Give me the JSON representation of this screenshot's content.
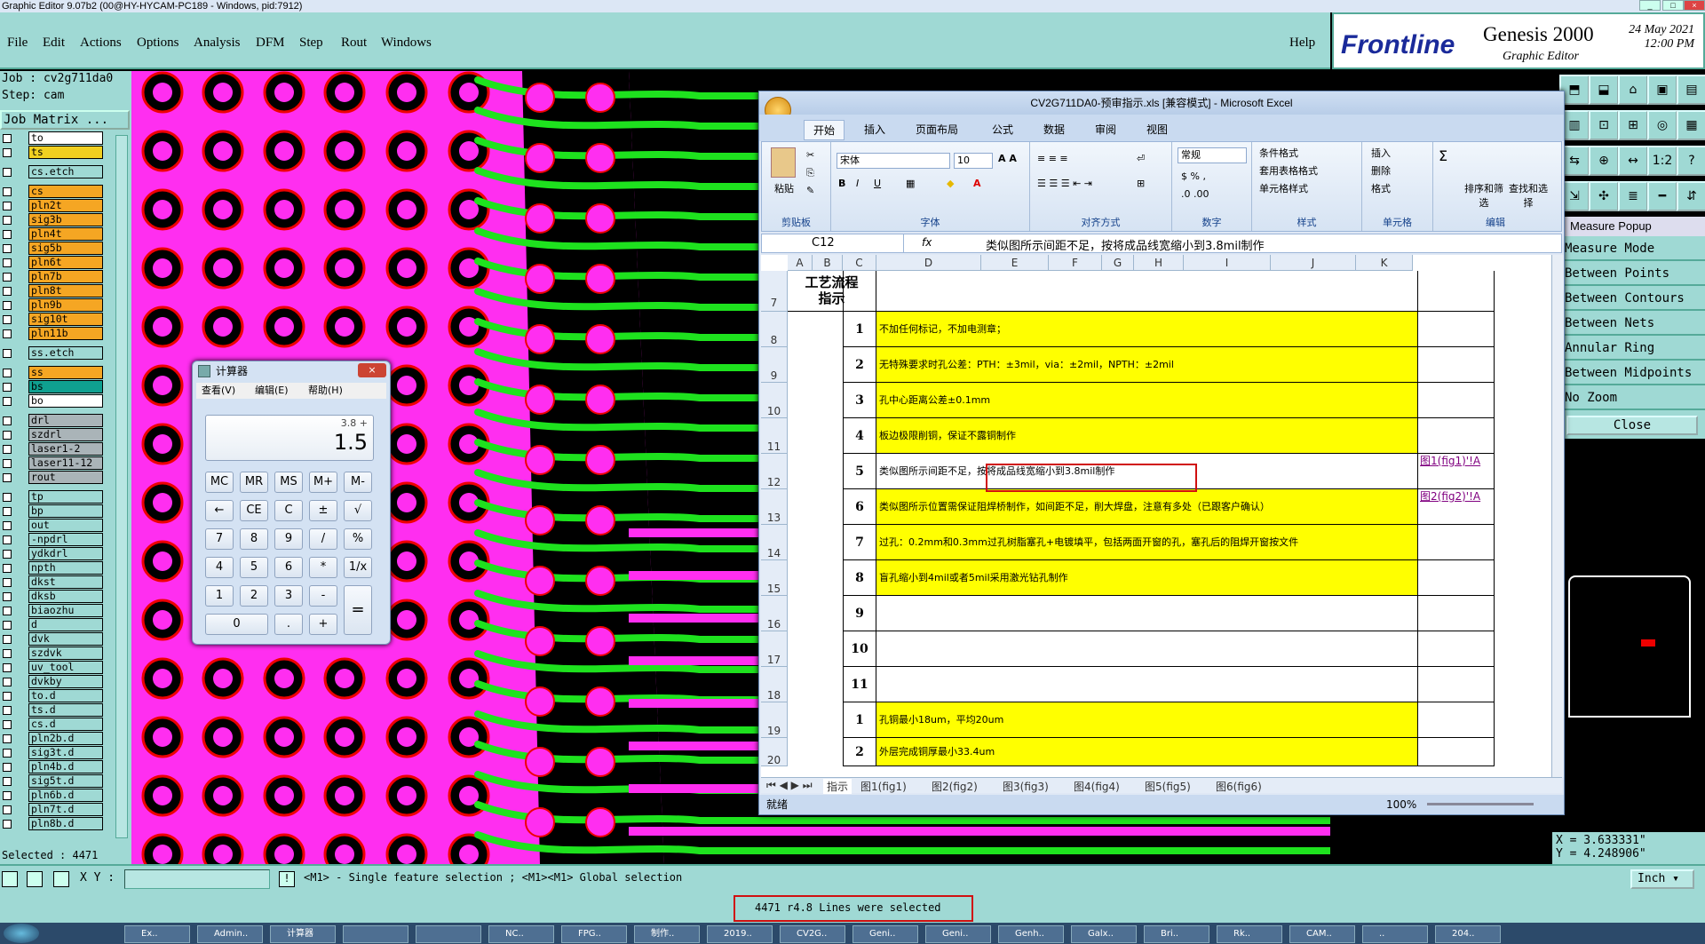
{
  "app": {
    "title": "Graphic Editor 9.07b2 (00@HY-HYCAM-PC189 - Windows, pid:7912)"
  },
  "menu": [
    "File",
    "Edit",
    "Actions",
    "Options",
    "Analysis",
    "DFM",
    "Step",
    "Rout",
    "Windows"
  ],
  "help": "Help",
  "brand": {
    "logo": "Frontline",
    "product": "Genesis 2000",
    "sub": "Graphic Editor",
    "date": "24 May 2021",
    "time": "12:00 PM"
  },
  "job": {
    "job": "Job : cv2g711da0",
    "step": "Step: cam",
    "matrix": "Job Matrix ..."
  },
  "layers": [
    {
      "name": "to",
      "color": "#ffffff"
    },
    {
      "name": "ts",
      "color": "#f0d020"
    },
    {
      "name": "cs.etch",
      "color": "#9fd9d4"
    },
    {
      "name": "cs",
      "color": "#f5a623"
    },
    {
      "name": "pln2t",
      "color": "#f5a623"
    },
    {
      "name": "sig3b",
      "color": "#f5a623"
    },
    {
      "name": "pln4t",
      "color": "#f5a623"
    },
    {
      "name": "sig5b",
      "color": "#f5a623"
    },
    {
      "name": "pln6t",
      "color": "#f5a623"
    },
    {
      "name": "pln7b",
      "color": "#f5a623"
    },
    {
      "name": "pln8t",
      "color": "#f5a623"
    },
    {
      "name": "pln9b",
      "color": "#f5a623"
    },
    {
      "name": "sig10t",
      "color": "#f5a623"
    },
    {
      "name": "pln11b",
      "color": "#f5a623"
    },
    {
      "name": "ss.etch",
      "color": "#9fd9d4"
    },
    {
      "name": "ss",
      "color": "#f5a623"
    },
    {
      "name": "bs",
      "color": "#0fa090"
    },
    {
      "name": "bo",
      "color": "#ffffff"
    },
    {
      "name": "drl",
      "color": "#aab4b8"
    },
    {
      "name": "szdrl",
      "color": "#aab4b8"
    },
    {
      "name": "laser1-2",
      "color": "#aab4b8"
    },
    {
      "name": "laser11-12",
      "color": "#aab4b8"
    },
    {
      "name": "rout",
      "color": "#aab4b8"
    },
    {
      "name": "tp",
      "color": "#9fd9d4"
    },
    {
      "name": "bp",
      "color": "#9fd9d4"
    },
    {
      "name": "out",
      "color": "#9fd9d4"
    },
    {
      "name": "-npdrl",
      "color": "#9fd9d4"
    },
    {
      "name": "ydkdrl",
      "color": "#9fd9d4"
    },
    {
      "name": "npth",
      "color": "#9fd9d4"
    },
    {
      "name": "dkst",
      "color": "#9fd9d4"
    },
    {
      "name": "dksb",
      "color": "#9fd9d4"
    },
    {
      "name": "biaozhu",
      "color": "#9fd9d4"
    },
    {
      "name": "d",
      "color": "#9fd9d4"
    },
    {
      "name": "dvk",
      "color": "#9fd9d4"
    },
    {
      "name": "szdvk",
      "color": "#9fd9d4"
    },
    {
      "name": "uv_tool",
      "color": "#9fd9d4"
    },
    {
      "name": "dvkby",
      "color": "#9fd9d4"
    },
    {
      "name": "to.d",
      "color": "#9fd9d4"
    },
    {
      "name": "ts.d",
      "color": "#9fd9d4"
    },
    {
      "name": "cs.d",
      "color": "#9fd9d4"
    },
    {
      "name": "pln2b.d",
      "color": "#9fd9d4"
    },
    {
      "name": "sig3t.d",
      "color": "#9fd9d4"
    },
    {
      "name": "pln4b.d",
      "color": "#9fd9d4"
    },
    {
      "name": "sig5t.d",
      "color": "#9fd9d4"
    },
    {
      "name": "pln6b.d",
      "color": "#9fd9d4"
    },
    {
      "name": "pln7t.d",
      "color": "#9fd9d4"
    },
    {
      "name": "pln8b.d",
      "color": "#9fd9d4"
    }
  ],
  "selected": "Selected : 4471",
  "measure": {
    "title": "Measure Popup",
    "items": [
      "Measure Mode",
      "Between Points",
      "Between Contours",
      "Between Nets",
      "Annular Ring",
      "Between Midpoints"
    ],
    "zoom": "No Zoom",
    "close": "Close"
  },
  "coords": {
    "x": "X = 3.633331\"",
    "y": "Y = 4.248906\""
  },
  "bottom": {
    "xy_label": "X Y :",
    "hint": "<M1> - Single feature selection ; <M1><M1> Global selection",
    "unit": "Inch"
  },
  "status": "4471 r4.8 Lines were selected",
  "excel": {
    "title": "CV2G711DA0-预审指示.xls  [兼容模式] - Microsoft Excel",
    "tabs": [
      "开始",
      "插入",
      "页面布局",
      "公式",
      "数据",
      "审阅",
      "视图"
    ],
    "font": "宋体",
    "size": "10",
    "numfmt": "常规",
    "groups": [
      "剪贴板",
      "字体",
      "对齐方式",
      "数字",
      "样式",
      "单元格",
      "编辑"
    ],
    "paste": "粘贴",
    "styles": [
      "条件格式",
      "套用表格格式",
      "单元格样式"
    ],
    "cellsops": [
      "插入",
      "删除",
      "格式"
    ],
    "edit": [
      "排序和筛选",
      "查找和选择"
    ],
    "cellref": "C12",
    "formula": "类似图所示间距不足，按将成品线宽缩小到3.8mil制作",
    "cols": [
      "A",
      "B",
      "C",
      "D",
      "E",
      "F",
      "G",
      "H",
      "I",
      "J",
      "K"
    ],
    "section": "工艺流程指示",
    "rows": [
      {
        "r": "7",
        "n": "",
        "t": "",
        "link": "",
        "yellow": false
      },
      {
        "r": "8",
        "n": "1",
        "t": "不加任何标记，不加电测章；",
        "link": "",
        "yellow": true
      },
      {
        "r": "9",
        "n": "2",
        "t": "无特殊要求时孔公差：PTH：±3mil，via：±2mil，NPTH：±2mil",
        "link": "",
        "yellow": true
      },
      {
        "r": "10",
        "n": "3",
        "t": "孔中心距离公差±0.1mm",
        "link": "",
        "yellow": true
      },
      {
        "r": "11",
        "n": "4",
        "t": "板边极限削铜，保证不露铜制作",
        "link": "",
        "yellow": true
      },
      {
        "r": "12",
        "n": "5",
        "t": "类似图所示间距不足，按将成品线宽缩小到3.8mil制作",
        "link": "图1(fig1)'!A",
        "yellow": false
      },
      {
        "r": "13",
        "n": "6",
        "t": "类似图所示位置需保证阻焊桥制作，如间距不足，削大焊盘，注意有多处（已跟客户确认）",
        "link": "图2(fig2)'!A",
        "yellow": true
      },
      {
        "r": "14",
        "n": "7",
        "t": "过孔：0.2mm和0.3mm过孔树脂塞孔+电镀填平，包括两面开窗的孔，塞孔后的阻焊开窗按文件",
        "link": "",
        "yellow": true
      },
      {
        "r": "15",
        "n": "8",
        "t": "盲孔缩小到4mil或者5mil采用激光钻孔制作",
        "link": "",
        "yellow": true
      },
      {
        "r": "16",
        "n": "9",
        "t": "",
        "link": "",
        "yellow": false
      },
      {
        "r": "17",
        "n": "10",
        "t": "",
        "link": "",
        "yellow": false
      },
      {
        "r": "18",
        "n": "11",
        "t": "",
        "link": "",
        "yellow": false
      },
      {
        "r": "19",
        "n": "1",
        "t": "孔铜最小18um，平均20um",
        "link": "",
        "yellow": true
      },
      {
        "r": "20",
        "n": "2",
        "t": "外层完成铜厚最小33.4um",
        "link": "",
        "yellow": true
      }
    ],
    "sheets": [
      "指示",
      "图1(fig1)",
      "图2(fig2)",
      "图3(fig3)",
      "图4(fig4)",
      "图5(fig5)",
      "图6(fig6)"
    ],
    "ready": "就绪",
    "zoom": "100%"
  },
  "calc": {
    "title": "计算器",
    "menu": [
      "查看(V)",
      "编辑(E)",
      "帮助(H)"
    ],
    "memory": "3.8 +",
    "value": "1.5",
    "keys": [
      [
        "MC",
        "MR",
        "MS",
        "M+",
        "M-"
      ],
      [
        "←",
        "CE",
        "C",
        "±",
        "√"
      ],
      [
        "7",
        "8",
        "9",
        "/",
        "%"
      ],
      [
        "4",
        "5",
        "6",
        "*",
        "1/x"
      ],
      [
        "1",
        "2",
        "3",
        "-",
        ""
      ],
      [
        "0",
        "",
        ".",
        "+",
        ""
      ]
    ],
    "equals": "="
  },
  "taskbar": [
    "Ex..",
    "Admin..",
    "计算器",
    "",
    "",
    "NC..",
    "FPG..",
    "制作..",
    "2019..",
    "CV2G..",
    "Geni..",
    "Geni..",
    "Genh..",
    "Galx..",
    "Bri..",
    "Rk..",
    "CAM..",
    "..",
    "204.."
  ]
}
